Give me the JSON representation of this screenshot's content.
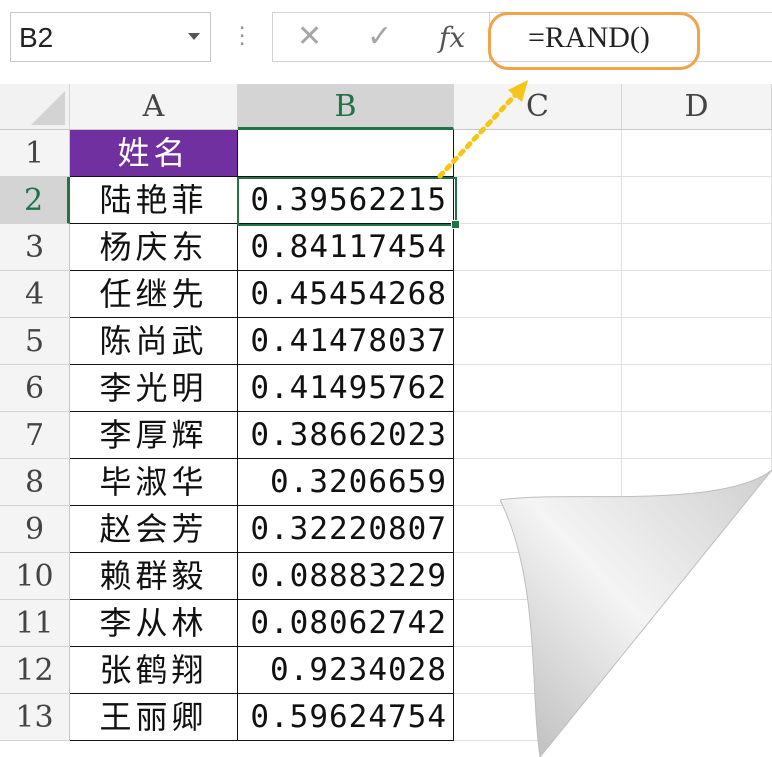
{
  "formula_bar": {
    "name_box": "B2",
    "cancel_icon": "✕",
    "enter_icon": "✓",
    "fx_label": "fx",
    "formula": "=RAND()"
  },
  "columns": [
    "A",
    "B",
    "C",
    "D"
  ],
  "rows": [
    {
      "num": "1",
      "a": "姓名",
      "b": ""
    },
    {
      "num": "2",
      "a": "陆艳菲",
      "b": "0.39562215"
    },
    {
      "num": "3",
      "a": "杨庆东",
      "b": "0.84117454"
    },
    {
      "num": "4",
      "a": "任继先",
      "b": "0.45454268"
    },
    {
      "num": "5",
      "a": "陈尚武",
      "b": "0.41478037"
    },
    {
      "num": "6",
      "a": "李光明",
      "b": "0.41495762"
    },
    {
      "num": "7",
      "a": "李厚辉",
      "b": "0.38662023"
    },
    {
      "num": "8",
      "a": "毕淑华",
      "b": "0.3206659"
    },
    {
      "num": "9",
      "a": "赵会芳",
      "b": "0.32220807"
    },
    {
      "num": "10",
      "a": "赖群毅",
      "b": "0.08883229"
    },
    {
      "num": "11",
      "a": "李从林",
      "b": "0.08062742"
    },
    {
      "num": "12",
      "a": "张鹤翔",
      "b": "0.9234028"
    },
    {
      "num": "13",
      "a": "王丽卿",
      "b": "0.59624754"
    }
  ],
  "colors": {
    "header_fill": "#7030a0",
    "selection": "#217346",
    "highlight": "#f0a34a",
    "arrow": "#f5c518"
  }
}
